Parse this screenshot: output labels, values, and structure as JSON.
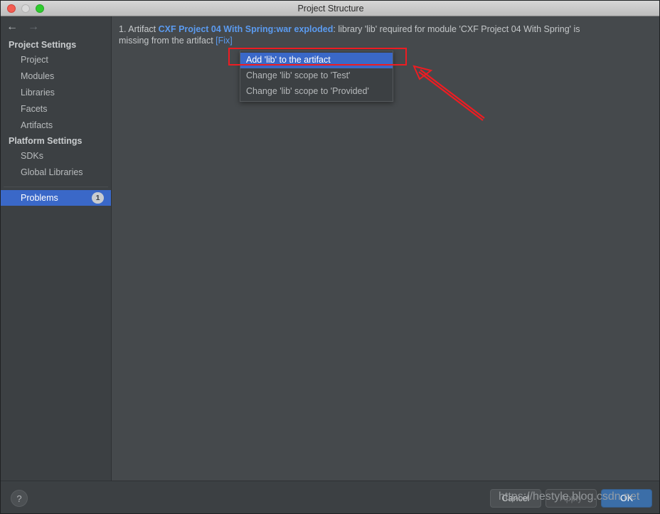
{
  "window": {
    "title": "Project Structure",
    "traffic_lights": [
      "close-red",
      "minimize-gray",
      "maximize-green"
    ]
  },
  "nav": {
    "back_icon": "arrow-left-icon",
    "back_glyph": "←",
    "forward_icon": "arrow-right-icon",
    "forward_glyph": "→"
  },
  "sidebar": {
    "groups": [
      {
        "title": "Project Settings",
        "items": [
          "Project",
          "Modules",
          "Libraries",
          "Facets",
          "Artifacts"
        ]
      },
      {
        "title": "Platform Settings",
        "items": [
          "SDKs",
          "Global Libraries"
        ]
      }
    ],
    "selected_item": {
      "label": "Problems",
      "badge": "1"
    }
  },
  "main": {
    "problem": {
      "number": "1.",
      "prefix": "Artifact ",
      "artifact_link": "CXF Project 04 With Spring:war exploded",
      "colon": ": ",
      "message_part1": "library 'lib' required for module 'CXF Project 04 With Spring' is",
      "message_part2": "missing from the artifact ",
      "fix_link": "[Fix]"
    },
    "menu": {
      "items": [
        {
          "label": "Add 'lib' to the artifact",
          "highlighted": true
        },
        {
          "label": "Change 'lib' scope to 'Test'",
          "highlighted": false
        },
        {
          "label": "Change 'lib' scope to 'Provided'",
          "highlighted": false
        }
      ]
    }
  },
  "annotations": {
    "highlight_box_color": "#ee1c22",
    "arrow_color": "#ee1c22"
  },
  "footer": {
    "help_label": "?",
    "buttons": [
      {
        "label": "Cancel",
        "state": "normal"
      },
      {
        "label": "Apply",
        "state": "disabled"
      },
      {
        "label": "OK",
        "state": "primary"
      }
    ]
  },
  "watermark": {
    "text": "https://hestyle.blog.csdn.net"
  },
  "colors": {
    "accent_blue": "#3a68c8",
    "link_blue": "#5b9bf0",
    "sidebar_bg": "#3c4043",
    "panel_bg": "#45494c",
    "annotation_red": "#ee1c22"
  }
}
